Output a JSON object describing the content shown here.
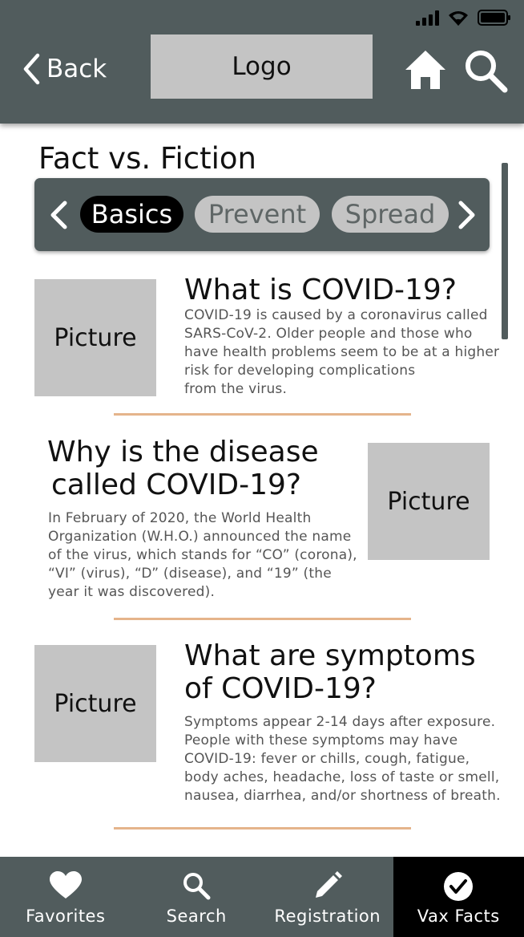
{
  "header": {
    "back_label": "Back",
    "logo_label": "Logo"
  },
  "page": {
    "title": "Fact vs. Fiction"
  },
  "tabs": [
    {
      "label": "Basics",
      "active": true
    },
    {
      "label": "Prevent",
      "active": false
    },
    {
      "label": "Spread",
      "active": false
    }
  ],
  "facts": [
    {
      "title_lines": [
        "What is COVID-19?"
      ],
      "body_lines": [
        "COVID-19 is caused by a coronavirus called",
        "SARS-CoV-2. Older people and those who",
        "have health problems seem to be at a higher",
        "risk for developing complications",
        "from the virus."
      ],
      "picture_label": "Picture"
    },
    {
      "title_lines": [
        "Why is the disease",
        "called COVID-19?"
      ],
      "body_lines": [
        "In February of 2020, the World Health",
        "Organization (W.H.O.) announced the name",
        "of the virus, which stands for “CO” (corona),",
        "“VI” (virus), “D” (disease), and “19” (the",
        "year it was discovered)."
      ],
      "picture_label": "Picture"
    },
    {
      "title_lines": [
        "What are symptoms",
        "of COVID-19?"
      ],
      "body_lines": [
        "Symptoms appear 2-14 days after exposure.",
        "People with these symptoms may have",
        "COVID-19: fever or chills, cough, fatigue,",
        "body aches, headache, loss of taste or smell,",
        "nausea, diarrhea, and/or shortness of breath."
      ],
      "picture_label": "Picture"
    }
  ],
  "nav": [
    {
      "label": "Favorites",
      "icon": "heart-icon",
      "active": false
    },
    {
      "label": "Search",
      "icon": "search-icon",
      "active": false
    },
    {
      "label": "Registration",
      "icon": "pencil-icon",
      "active": false
    },
    {
      "label": "Vax Facts",
      "icon": "check-circle-icon",
      "active": true
    }
  ],
  "colors": {
    "header_bg": "#515c5d",
    "accent_divider": "#e5b48b",
    "placeholder": "#c4c4c4",
    "active_tab": "#000000"
  }
}
